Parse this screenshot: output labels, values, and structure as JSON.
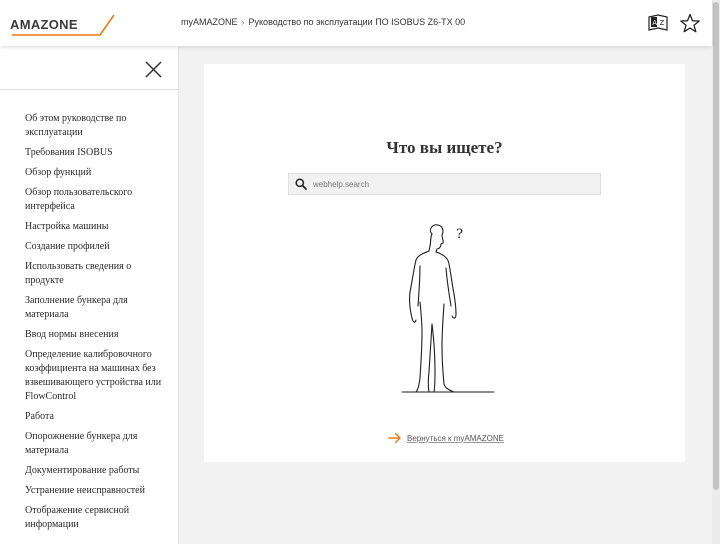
{
  "header": {
    "logo_text": "AMAZONE",
    "breadcrumb": [
      "myAMAZONE",
      "Руководство по эксплуатации ПО ISOBUS Z6-TX 00"
    ],
    "breadcrumb_sep": "›",
    "icons": [
      "language-az-icon",
      "star-icon"
    ]
  },
  "sidebar": {
    "close_icon": "close-icon",
    "items": [
      "Об этом руководстве по эксплуатации",
      "Требования ISOBUS",
      "Обзор функций",
      "Обзор пользовательского интерфейса",
      "Настройка машины",
      "Создание профилей",
      "Использовать сведения о продукте",
      "Заполнение бункера для материала",
      "Ввод нормы внесения",
      "Определение калибровочного коэффициента на машинах без взвешивающего устройства или FlowControl",
      "Работа",
      "Опорожнение бункера для материала",
      "Документирование работы",
      "Устранение неисправностей",
      "Отображение сервисной информации"
    ]
  },
  "main": {
    "heading": "Что вы ищете?",
    "search_placeholder": "webhelp.search",
    "search_icon": "search-icon",
    "figure_text": "?",
    "back_link": "Вернуться к myAMAZONE",
    "back_icon": "arrow-right-icon"
  },
  "colors": {
    "accent": "#e8781a",
    "logo": "#3a3a3a"
  }
}
